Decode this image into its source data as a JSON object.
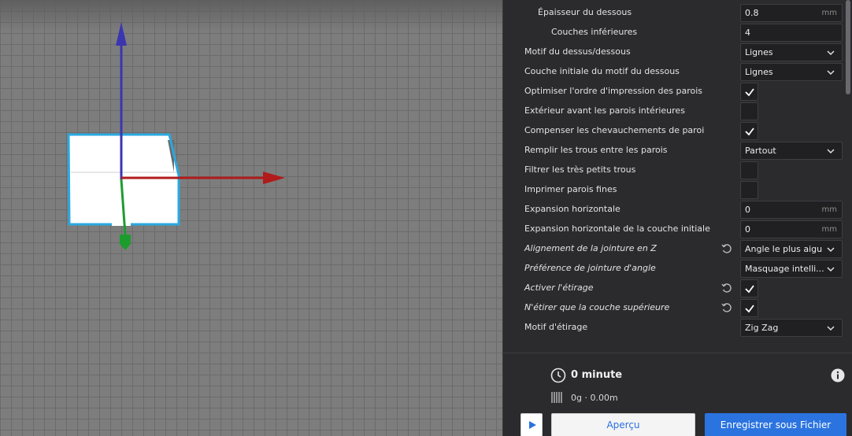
{
  "settings": {
    "rows": [
      {
        "label": "Épaisseur du dessous",
        "value": "0.8",
        "unit": "mm"
      },
      {
        "label": "Couches inférieures",
        "value": "4"
      },
      {
        "label": "Motif du dessus/dessous",
        "value": "Lignes"
      },
      {
        "label": "Couche initiale du motif du dessous",
        "value": "Lignes"
      },
      {
        "label": "Optimiser l'ordre d'impression des parois",
        "checked": "true"
      },
      {
        "label": "Extérieur avant les parois intérieures",
        "checked": "false"
      },
      {
        "label": "Compenser les chevauchements de paroi",
        "checked": "true"
      },
      {
        "label": "Remplir les trous entre les parois",
        "value": "Partout"
      },
      {
        "label": "Filtrer les très petits trous",
        "checked": "false"
      },
      {
        "label": "Imprimer parois fines",
        "checked": "false"
      },
      {
        "label": "Expansion horizontale",
        "value": "0",
        "unit": "mm"
      },
      {
        "label": "Expansion horizontale de la couche initiale",
        "value": "0",
        "unit": "mm"
      },
      {
        "label": "Alignement de la jointure en Z",
        "value": "Angle le plus aigu"
      },
      {
        "label": "Préférence de jointure d'angle",
        "value": "Masquage intelli..."
      },
      {
        "label": "Activer l'étirage",
        "checked": "true"
      },
      {
        "label": "N'étirer que la couche supérieure",
        "checked": "true"
      },
      {
        "label": "Motif d'étirage",
        "value": "Zig Zag"
      }
    ]
  },
  "footer": {
    "print_time": "0 minute",
    "material": "0g · 0.00m",
    "preview_label": "Aperçu",
    "save_label": "Enregistrer sous Fichier"
  },
  "icons": {
    "clock": "clock-icon",
    "material": "spool-icon",
    "info": "info-icon",
    "reset": "reset-icon",
    "check": "checkmark-icon",
    "dropdown": "chevron-down-icon",
    "play": "play-icon"
  },
  "colors": {
    "accent": "#2b74e0",
    "panel_bg": "#2b2b2e",
    "selection_outline": "#29a9e1",
    "axis_x": "#b11b1b",
    "axis_y": "#1d9c2e",
    "axis_z": "#3b36b0"
  }
}
